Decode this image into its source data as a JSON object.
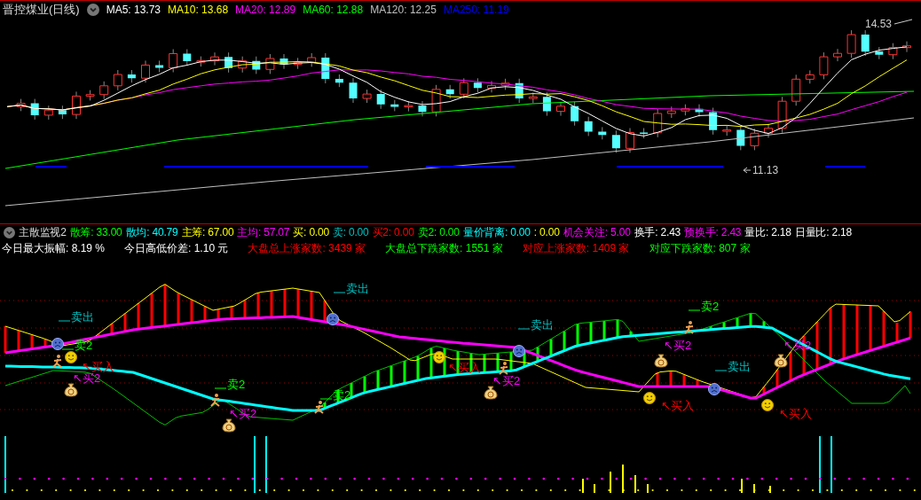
{
  "header": {
    "title": "晋控煤业(日线)",
    "ma": [
      {
        "text": "MA5: 13.73",
        "color": "#ffffff"
      },
      {
        "text": "MA10: 13.68",
        "color": "#ffff00"
      },
      {
        "text": "MA20: 12.89",
        "color": "#ff00ff"
      },
      {
        "text": "MA60: 12.88",
        "color": "#00ff00"
      },
      {
        "text": "MA120: 12.25",
        "color": "#c0c0c0"
      },
      {
        "text": "MA250: 11.19",
        "color": "#0000ff"
      }
    ]
  },
  "price_chart": {
    "high_label": "14.53",
    "low_label": "11.13"
  },
  "indicator": {
    "title": "主散监视2",
    "stats": [
      {
        "text": "散筹: 33.00",
        "color": "#00ff00"
      },
      {
        "text": "散均: 40.79",
        "color": "#00ffff"
      },
      {
        "text": "主筹: 67.00",
        "color": "#ffff00"
      },
      {
        "text": "主均: 57.07",
        "color": "#ff00ff"
      },
      {
        "text": "买: 0.00",
        "color": "#ffff00"
      },
      {
        "text": "卖: 0.00",
        "color": "#00c0c0"
      },
      {
        "text": "买2: 0.00",
        "color": "#ff0000"
      },
      {
        "text": "卖2: 0.00",
        "color": "#00ff00"
      },
      {
        "text": "量价背离: 0.00",
        "color": "#00ffff"
      },
      {
        "text": ": 0.00",
        "color": "#ffff00"
      },
      {
        "text": "机会关注: 5.00",
        "color": "#ff00ff"
      },
      {
        "text": "换手: 2.43",
        "color": "#ffffff"
      },
      {
        "text": "预换手: 2.43",
        "color": "#ff00ff"
      },
      {
        "text": "量比: 2.18",
        "color": "#ffffff"
      },
      {
        "text": "日量比: 2.18",
        "color": "#ffffff"
      }
    ],
    "market": [
      {
        "text": "今日最大振幅: 8.19 %",
        "color": "#ffffff"
      },
      {
        "text": "今日高低价差: 1.10 元",
        "color": "#ffffff"
      },
      {
        "text": "大盘总上涨家数: 3439 家",
        "color": "#ff0000"
      },
      {
        "text": "大盘总下跌家数: 1551 家",
        "color": "#00ff00"
      },
      {
        "text": "对应上涨家数: 1409 家",
        "color": "#ff0000"
      },
      {
        "text": "对应下跌家数: 807 家",
        "color": "#00ff00"
      }
    ]
  },
  "signals": [
    {
      "kind": "sell",
      "text": "卖出"
    },
    {
      "kind": "sell2",
      "text": "卖2"
    },
    {
      "kind": "buy",
      "text": "↖买入"
    },
    {
      "kind": "buy2",
      "text": "↖买2"
    },
    {
      "kind": "sell2",
      "text": "卖2"
    },
    {
      "kind": "buy2",
      "text": "↖买2"
    },
    {
      "kind": "sell",
      "text": "卖出"
    },
    {
      "kind": "sell2",
      "text": "卖2"
    },
    {
      "kind": "buy",
      "text": "↖买入"
    },
    {
      "kind": "buy2",
      "text": "↖买2"
    },
    {
      "kind": "sell",
      "text": "卖出"
    },
    {
      "kind": "buy2",
      "text": "↖买2"
    },
    {
      "kind": "sell2",
      "text": "卖2"
    },
    {
      "kind": "sell",
      "text": "卖出"
    },
    {
      "kind": "buy",
      "text": "↖买入"
    },
    {
      "kind": "buy2",
      "text": "↖买2"
    },
    {
      "kind": "buy",
      "text": "↖买入"
    }
  ]
}
